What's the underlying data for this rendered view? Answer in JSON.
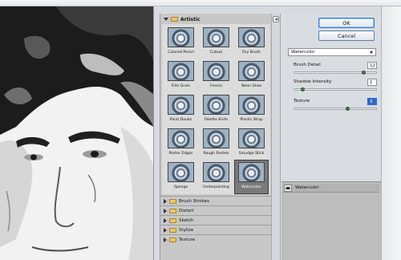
{
  "dialog": {
    "ok_label": "OK",
    "cancel_label": "Cancel"
  },
  "gallery": {
    "open_category": "Artistic",
    "filters": [
      {
        "label": "Colored Pencil",
        "selected": false
      },
      {
        "label": "Cutout",
        "selected": false
      },
      {
        "label": "Dry Brush",
        "selected": false
      },
      {
        "label": "Film Grain",
        "selected": false
      },
      {
        "label": "Fresco",
        "selected": false
      },
      {
        "label": "Neon Glow",
        "selected": false
      },
      {
        "label": "Paint Daubs",
        "selected": false
      },
      {
        "label": "Palette Knife",
        "selected": false
      },
      {
        "label": "Plastic Wrap",
        "selected": false
      },
      {
        "label": "Poster Edges",
        "selected": false
      },
      {
        "label": "Rough Pastels",
        "selected": false
      },
      {
        "label": "Smudge Stick",
        "selected": false
      },
      {
        "label": "Sponge",
        "selected": false
      },
      {
        "label": "Underpainting",
        "selected": false
      },
      {
        "label": "Watercolor",
        "selected": true
      }
    ],
    "collapsed_categories": [
      "Brush Strokes",
      "Distort",
      "Sketch",
      "Stylize",
      "Texture"
    ]
  },
  "settings": {
    "selected_filter": "Watercolor",
    "params": [
      {
        "label": "Brush Detail",
        "value": "12",
        "level": 0.86
      },
      {
        "label": "Shadow Intensity",
        "value": "1",
        "level": 0.1
      },
      {
        "label": "Texture",
        "value": "3",
        "level": 0.66
      }
    ]
  },
  "layers": {
    "items": [
      {
        "name": "Watercolor",
        "visible": true
      }
    ]
  }
}
